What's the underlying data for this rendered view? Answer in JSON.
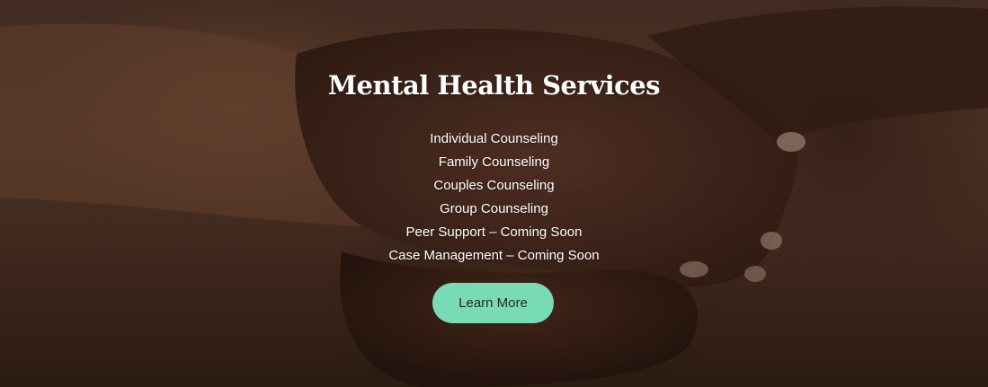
{
  "hero": {
    "title": "Mental Health Services",
    "services": [
      "Individual Counseling",
      "Family Counseling",
      "Couples Counseling",
      "Group Counseling",
      "Peer Support – Coming Soon",
      "Case Management – Coming Soon"
    ],
    "cta_label": "Learn More",
    "accent_color": "#79dbb5",
    "background_image": "held-hands-photo"
  }
}
